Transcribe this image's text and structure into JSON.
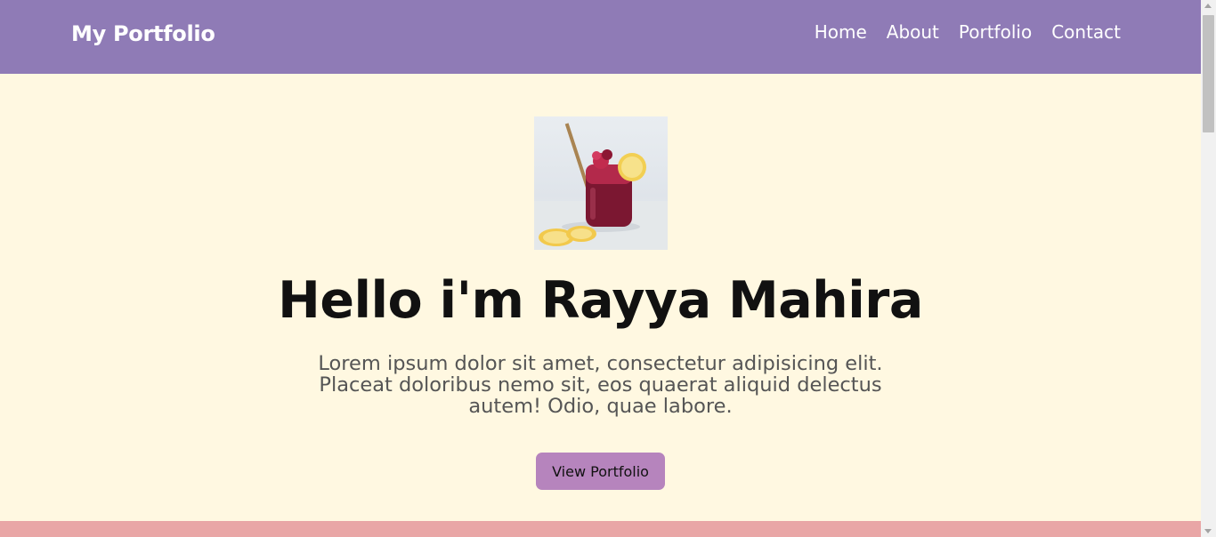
{
  "navbar": {
    "brand": "My Portfolio",
    "links": [
      "Home",
      "About",
      "Portfolio",
      "Contact"
    ]
  },
  "hero": {
    "image_alt": "Berry drink with lemon slices",
    "title": "Hello i'm Rayya Mahira",
    "text": "Lorem ipsum dolor sit amet, consectetur adipisicing elit. Placeat doloribus nemo sit, eos quaerat aliquid delectus autem! Odio, quae labore.",
    "button": "View Portfolio"
  },
  "colors": {
    "navbar": "#8f7bb6",
    "hero_background": "#fff8e1",
    "button": "#b684bd",
    "next_section": "#e9a6a6"
  }
}
